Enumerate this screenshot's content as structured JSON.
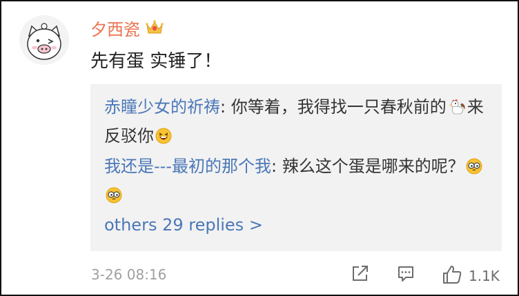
{
  "comment": {
    "username": "夕西瓷",
    "badge_icon": "crown-icon",
    "text": "先有蛋 实锤了！",
    "timestamp": "3-26 08:16",
    "likes": "1.1K"
  },
  "replies": [
    {
      "author": "赤瞳少女的祈祷",
      "sep": ": ",
      "text_before": "你等着，我得找一只春秋前的",
      "emoji_1": "rooster-emoji",
      "text_after": "来反驳你",
      "emoji_2": "laughing-emoji"
    },
    {
      "author": "我还是---最初的那个我",
      "sep": ": ",
      "text": "辣么这个蛋是哪来的呢？",
      "emoji": "glasses-emoji"
    }
  ],
  "more_replies": "others 29 replies >",
  "icons": {
    "share": "share-icon",
    "comment": "comment-icon",
    "like": "thumbs-up-icon"
  },
  "colors": {
    "username": "#eb7350",
    "link": "#4a77b8",
    "reply_bg": "#f2f2f2",
    "meta": "#a0a0a0"
  }
}
